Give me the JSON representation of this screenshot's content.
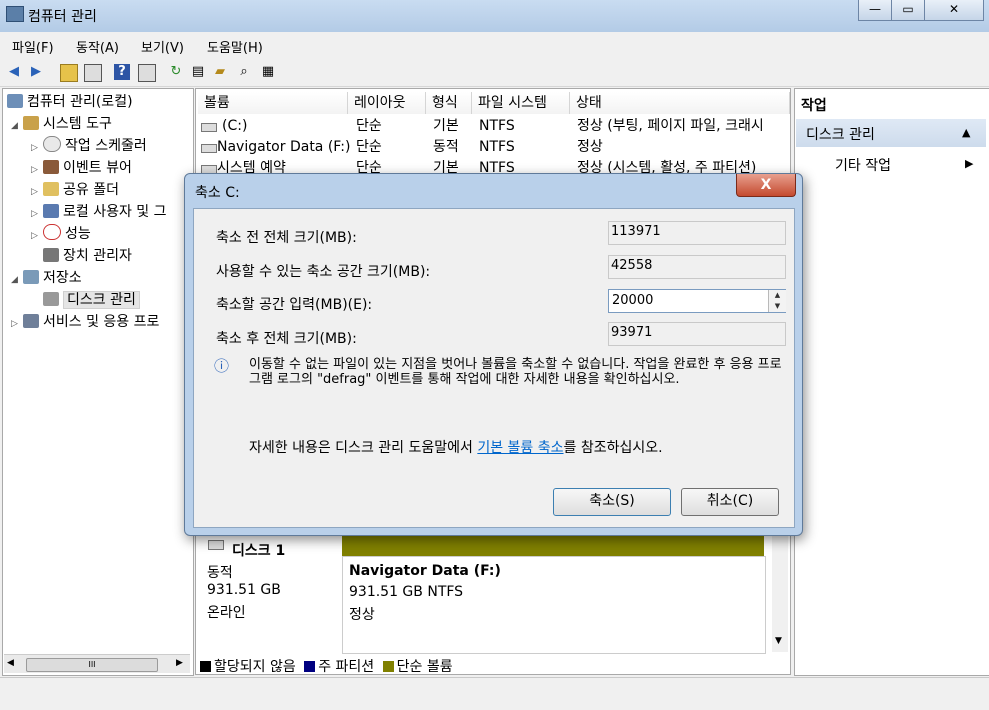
{
  "window": {
    "title": "컴퓨터 관리",
    "controls": {
      "minimize": "—",
      "maximize": "▭",
      "close": "✕"
    }
  },
  "menu": [
    "파일(F)",
    "동작(A)",
    "보기(V)",
    "도움말(H)"
  ],
  "tree": {
    "root": "컴퓨터 관리(로컬)",
    "items": [
      {
        "label": "시스템 도구",
        "level": 1,
        "expander": "◢"
      },
      {
        "label": "작업 스케줄러",
        "level": 2,
        "expander": "▷"
      },
      {
        "label": "이벤트 뷰어",
        "level": 2,
        "expander": "▷"
      },
      {
        "label": "공유 폴더",
        "level": 2,
        "expander": "▷"
      },
      {
        "label": "로컬 사용자 및 그",
        "level": 2,
        "expander": "▷"
      },
      {
        "label": "성능",
        "level": 2,
        "expander": "▷"
      },
      {
        "label": "장치 관리자",
        "level": 2,
        "expander": ""
      },
      {
        "label": "저장소",
        "level": 1,
        "expander": "◢"
      },
      {
        "label": "디스크 관리",
        "level": 2,
        "expander": ""
      },
      {
        "label": "서비스 및 응용 프로",
        "level": 1,
        "expander": "▷"
      }
    ],
    "scroll_thumb": "III"
  },
  "volumes": {
    "columns": [
      "볼륨",
      "레이아웃",
      "형식",
      "파일 시스템",
      "상태"
    ],
    "rows": [
      {
        "volume": "(C:)",
        "layout": "단순",
        "type": "기본",
        "fs": "NTFS",
        "status": "정상 (부팅, 페이지 파일, 크래시"
      },
      {
        "volume": "Navigator Data (F:)",
        "layout": "단순",
        "type": "동적",
        "fs": "NTFS",
        "status": "정상"
      },
      {
        "volume": "시스템 예약",
        "layout": "단순",
        "type": "기본",
        "fs": "NTFS",
        "status": "정상 (시스템, 활성, 주 파티션)"
      }
    ]
  },
  "diskmap": {
    "disk_label": "디스크 1",
    "disk_type": "동적",
    "disk_size": "931.51 GB",
    "disk_state": "온라인",
    "partition_name": "Navigator Data  (F:)",
    "partition_size": "931.51 GB NTFS",
    "partition_status": "정상",
    "partition_bar_color": "#808000"
  },
  "legend": [
    {
      "label": "할당되지 않음",
      "color": "#000000"
    },
    {
      "label": "주 파티션",
      "color": "#000080"
    },
    {
      "label": "단순 볼륨",
      "color": "#808000"
    }
  ],
  "actions": {
    "header": "작업",
    "section": "디스크 관리",
    "section_arrow": "▲",
    "more": "기타 작업",
    "more_arrow": "▶"
  },
  "dialog": {
    "title": "축소 C:",
    "close_label": "X",
    "fields": {
      "total_before_label": "축소 전 전체 크기(MB):",
      "total_before_value": "113971",
      "available_label": "사용할 수 있는 축소 공간 크기(MB):",
      "available_value": "42558",
      "shrink_label": "축소할 공간 입력(MB)(E):",
      "shrink_value": "20000",
      "total_after_label": "축소 후 전체 크기(MB):",
      "total_after_value": "93971"
    },
    "info_icon": "ⓘ",
    "info_text": "이동할 수 없는 파일이 있는 지점을 벗어나 볼륨을 축소할 수 없습니다. 작업을 완료한 후 응용 프로그램 로그의 \"defrag\" 이벤트를 통해 작업에 대한 자세한 내용을 확인하십시오.",
    "help_prefix": "자세한 내용은 디스크 관리 도움말에서 ",
    "help_link": "기본 볼륨 축소",
    "help_suffix": "를 참조하십시오.",
    "ok_button": "축소(S)",
    "cancel_button": "취소(C)"
  }
}
